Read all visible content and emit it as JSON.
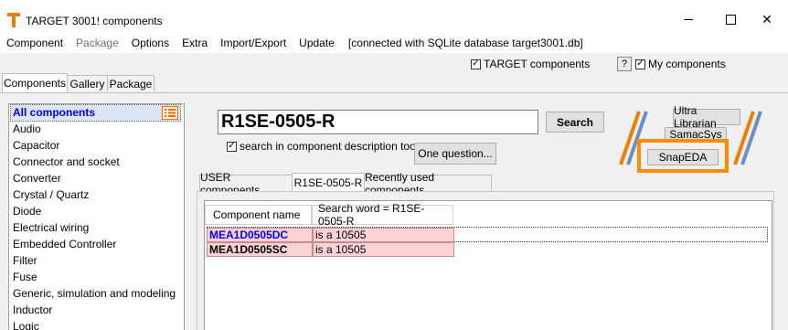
{
  "window": {
    "title": "TARGET 3001! components",
    "minimize_label": "",
    "maximize_label": "",
    "close_label": "✕"
  },
  "menu": {
    "items": [
      "Component",
      "Package",
      "Options",
      "Extra",
      "Import/Export",
      "Update"
    ],
    "status": "[connected with SQLite database target3001.db]"
  },
  "options": {
    "target_components": "TARGET components",
    "target_components_checked": true,
    "help_label": "?",
    "my_components": "My components",
    "my_components_checked": true
  },
  "tabs": [
    "Components",
    "Gallery",
    "Package"
  ],
  "categories": [
    "All components",
    "Audio",
    "Capacitor",
    "Connector and socket",
    "Converter",
    "Crystal / Quartz",
    "Diode",
    "Electrical wiring",
    "Embedded Controller",
    "Filter",
    "Fuse",
    "Generic, simulation and modeling",
    "Inductor",
    "Logic"
  ],
  "search": {
    "value": "R1SE-0505-R",
    "button": "Search",
    "description_checkbox": "search in component description too",
    "description_checked": true,
    "question_button": "One question..."
  },
  "providers": {
    "ultra_librarian": "Ultra Librarian",
    "samacsys": "SamacSys",
    "snapeda": "SnapEDA",
    "accent_orange": "#ff8c00"
  },
  "result_tabs": [
    "USER components",
    "R1SE-0505-R",
    "Recently used components"
  ],
  "results": {
    "headers": [
      "Component name",
      "Search word =  R1SE-0505-R"
    ],
    "rows": [
      {
        "name": "MEA1D0505DC",
        "match": "is a 10505"
      },
      {
        "name": "MEA1D0505SC",
        "match": "is a 10505"
      }
    ]
  }
}
